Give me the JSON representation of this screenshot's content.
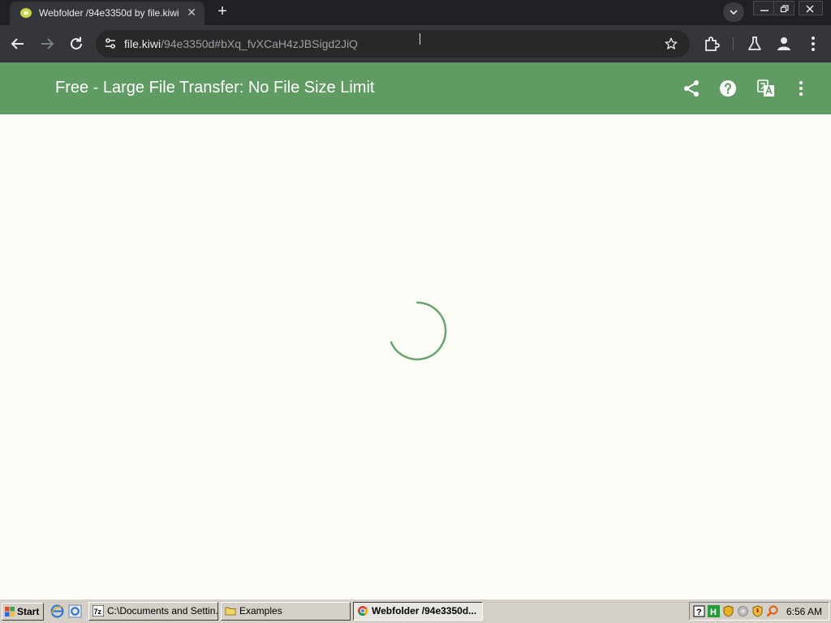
{
  "browser": {
    "tab_title": "Webfolder /94e3350d by file.kiwi",
    "tab_close": "✕",
    "new_tab": "+",
    "url_host": "file.kiwi",
    "url_rest": "/94e3350d#bXq_fvXCaH4zJBSigd2JiQ"
  },
  "app": {
    "title": "Free - Large File Transfer: No File Size Limit",
    "icons": [
      "share-icon",
      "help-icon",
      "translate-icon",
      "more-vert-icon"
    ],
    "accent_color": "#5f9b62"
  },
  "content": {
    "loading": true,
    "spinner_color": "#6aa36d"
  },
  "taskbar": {
    "start_label": "Start",
    "tasks": [
      {
        "label": "C:\\Documents and Settin...",
        "active": false
      },
      {
        "label": "Examples",
        "active": false
      },
      {
        "label": "Webfolder /94e3350d...",
        "active": true
      }
    ],
    "clock": "6:56 AM"
  }
}
